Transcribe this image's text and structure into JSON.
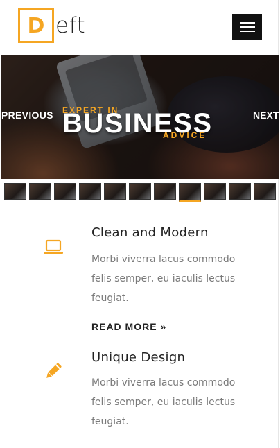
{
  "header": {
    "logo_letter": "D",
    "logo_rest": "eft",
    "menu_icon": "hamburger-icon"
  },
  "hero": {
    "prev_label": "PREVIOUS",
    "next_label": "NEXT",
    "pre_title": "EXPERT IN",
    "title": "BUSINESS",
    "post_title": "ADVICE",
    "thumbnail_count": 11,
    "active_thumbnail": 8
  },
  "features": [
    {
      "icon": "laptop-icon",
      "title": "Clean and Modern",
      "text": "Morbi viverra lacus commodo felis semper, eu iaculis lectus feugiat.",
      "link": "READ MORE »"
    },
    {
      "icon": "pencil-icon",
      "title": "Unique Design",
      "text": "Morbi viverra lacus commodo felis semper, eu iaculis lectus feugiat."
    }
  ],
  "colors": {
    "accent": "#f5a623",
    "text_dark": "#222222",
    "text_muted": "#7a7a7a",
    "menu_bg": "#111111"
  }
}
